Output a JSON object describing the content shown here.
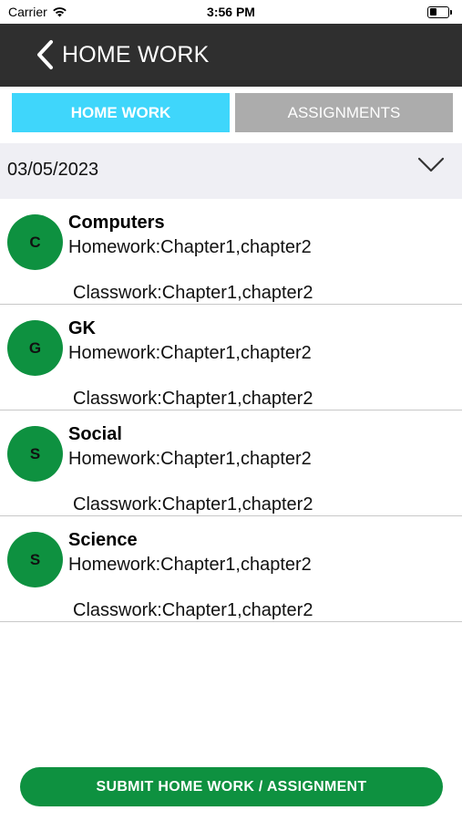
{
  "status_bar": {
    "carrier": "Carrier",
    "time": "3:56 PM"
  },
  "nav": {
    "title": "HOME WORK",
    "back_icon": "chevron-left-icon"
  },
  "tabs": [
    {
      "label": "HOME WORK",
      "active": true
    },
    {
      "label": "ASSIGNMENTS",
      "active": false
    }
  ],
  "date_selector": {
    "value": "03/05/2023",
    "icon": "chevron-down-icon"
  },
  "entries": [
    {
      "initial": "C",
      "subject": "Computers",
      "homework": "Homework:Chapter1,chapter2",
      "classwork": "Classwork:Chapter1,chapter2"
    },
    {
      "initial": "G",
      "subject": "GK",
      "homework": "Homework:Chapter1,chapter2",
      "classwork": "Classwork:Chapter1,chapter2"
    },
    {
      "initial": "S",
      "subject": "Social",
      "homework": "Homework:Chapter1,chapter2",
      "classwork": "Classwork:Chapter1,chapter2"
    },
    {
      "initial": "S",
      "subject": "Science",
      "homework": "Homework:Chapter1,chapter2",
      "classwork": "Classwork:Chapter1,chapter2"
    }
  ],
  "submit_label": "SUBMIT HOME WORK / ASSIGNMENT",
  "colors": {
    "nav_bg": "#2f2f2f",
    "tab_active": "#3fd6fb",
    "tab_inactive": "#acacac",
    "accent_green": "#0e9140",
    "date_bar_bg": "#efeff4"
  }
}
